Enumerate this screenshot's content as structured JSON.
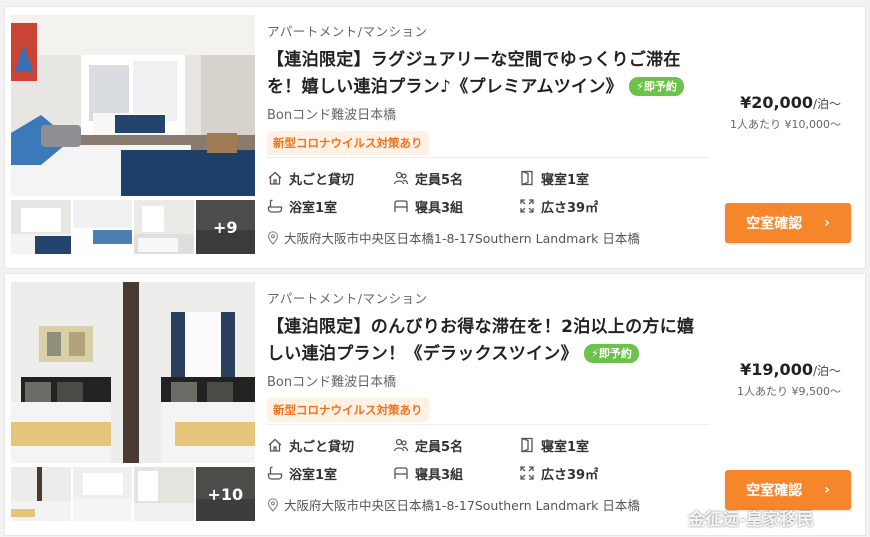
{
  "listings": [
    {
      "property_type": "アパートメント/マンション",
      "title_line1": "【連泊限定】ラグジュアリーな空間でゆっくりご滞在",
      "title_line2": "を！嬉しい連泊プラン♪《プレミアムツイン》",
      "instant_badge": "⚡即予約",
      "building": "Bonコンド難波日本橋",
      "covid_tag": "新型コロナウイルス対策あり",
      "features": [
        "丸ごと貸切",
        "定員5名",
        "寝室1室",
        "浴室1室",
        "寝具3組",
        "広さ39㎡"
      ],
      "address": "大阪府大阪市中央区日本橋1-8-17Southern Landmark 日本橋",
      "price": "¥20,000",
      "price_unit": "/泊〜",
      "per_person": "1人あたり ¥10,000〜",
      "cta": "空室確認",
      "more_photos": "+9"
    },
    {
      "property_type": "アパートメント/マンション",
      "title_line1": "【連泊限定】のんびりお得な滞在を！2泊以上の方に嬉",
      "title_line2": "しい連泊プラン！《デラックスツイン》",
      "instant_badge": "⚡即予約",
      "building": "Bonコンド難波日本橋",
      "covid_tag": "新型コロナウイルス対策あり",
      "features": [
        "丸ごと貸切",
        "定員5名",
        "寝室1室",
        "浴室1室",
        "寝具3組",
        "広さ39㎡"
      ],
      "address": "大阪府大阪市中央区日本橋1-8-17Southern Landmark 日本橋",
      "price": "¥19,000",
      "price_unit": "/泊〜",
      "per_person": "1人あたり ¥9,500〜",
      "cta": "空室確認",
      "more_photos": "+10"
    }
  ],
  "feature_icons": [
    "house-icon",
    "people-icon",
    "bed-door-icon",
    "bath-icon",
    "bedding-icon",
    "area-expand-icon"
  ],
  "watermark": "金征远-皇家移民",
  "colors": {
    "accent": "#f5862b",
    "instant": "#6cc24a",
    "covid_text": "#f0731e",
    "covid_bg": "#fff1e4"
  }
}
